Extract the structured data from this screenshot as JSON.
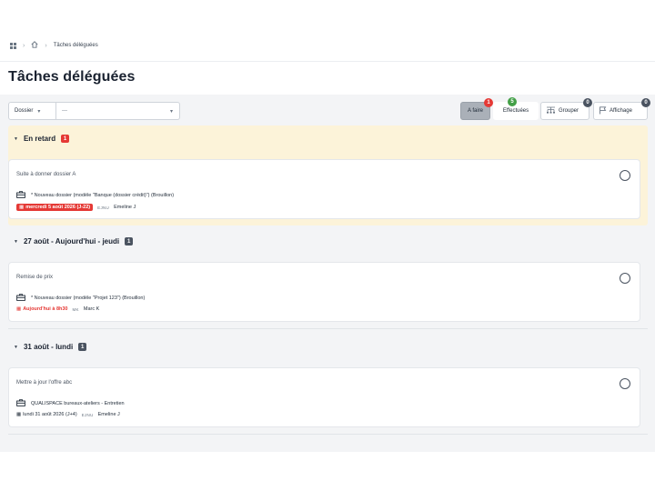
{
  "breadcrumb": {
    "current": "Tâches déléguées"
  },
  "page": {
    "title": "Tâches déléguées"
  },
  "toolbar": {
    "dossier_label": "Dossier",
    "filter_value": "---",
    "afaire_label": "A faire",
    "afaire_count": "1",
    "effectuees_label": "Effectuées",
    "effectuees_count": "5",
    "grouper_label": "Grouper",
    "grouper_count": "0",
    "affichage_label": "Affichage",
    "affichage_count": "0"
  },
  "groups": [
    {
      "title": "En retard",
      "count": "1",
      "task": {
        "title": "Suite à donner dossier A",
        "dossier": "* Nouveau dossier (modèle \"Banque (dossier crédit)\") (Brouillon)",
        "date": "mercredi 5 août 2026 (J-22)",
        "initials": "EJNU",
        "assignee": "Emeline J"
      }
    },
    {
      "title": "27 août - Aujourd'hui - jeudi",
      "count": "1",
      "task": {
        "title": "Remise de prix",
        "dossier": "* Nouveau dossier (modèle \"Projet 123\") (Brouillon)",
        "date": "Aujourd'hui à 8h30",
        "initials": "MK",
        "assignee": "Marc K"
      }
    },
    {
      "title": "31 août - lundi",
      "count": "1",
      "task": {
        "title": "Mettre à jour l'offre abc",
        "dossier": "QUALISPACE bureaux-ateliers - Entretien",
        "date": "lundi 31 août 2026 (J+4)",
        "initials": "EJNU",
        "assignee": "Emeline J"
      }
    }
  ],
  "colors": {
    "late_bg": "#fcf3d9",
    "danger": "#e53935",
    "success": "#43a047",
    "neutral_badge": "#4a5360"
  },
  "icons": [
    "apps-grid-icon",
    "home-icon",
    "chevron-right-icon",
    "chevron-down-icon",
    "briefcase-icon",
    "calendar-icon",
    "group-icon",
    "flag-icon",
    "circle-checkbox-icon"
  ]
}
